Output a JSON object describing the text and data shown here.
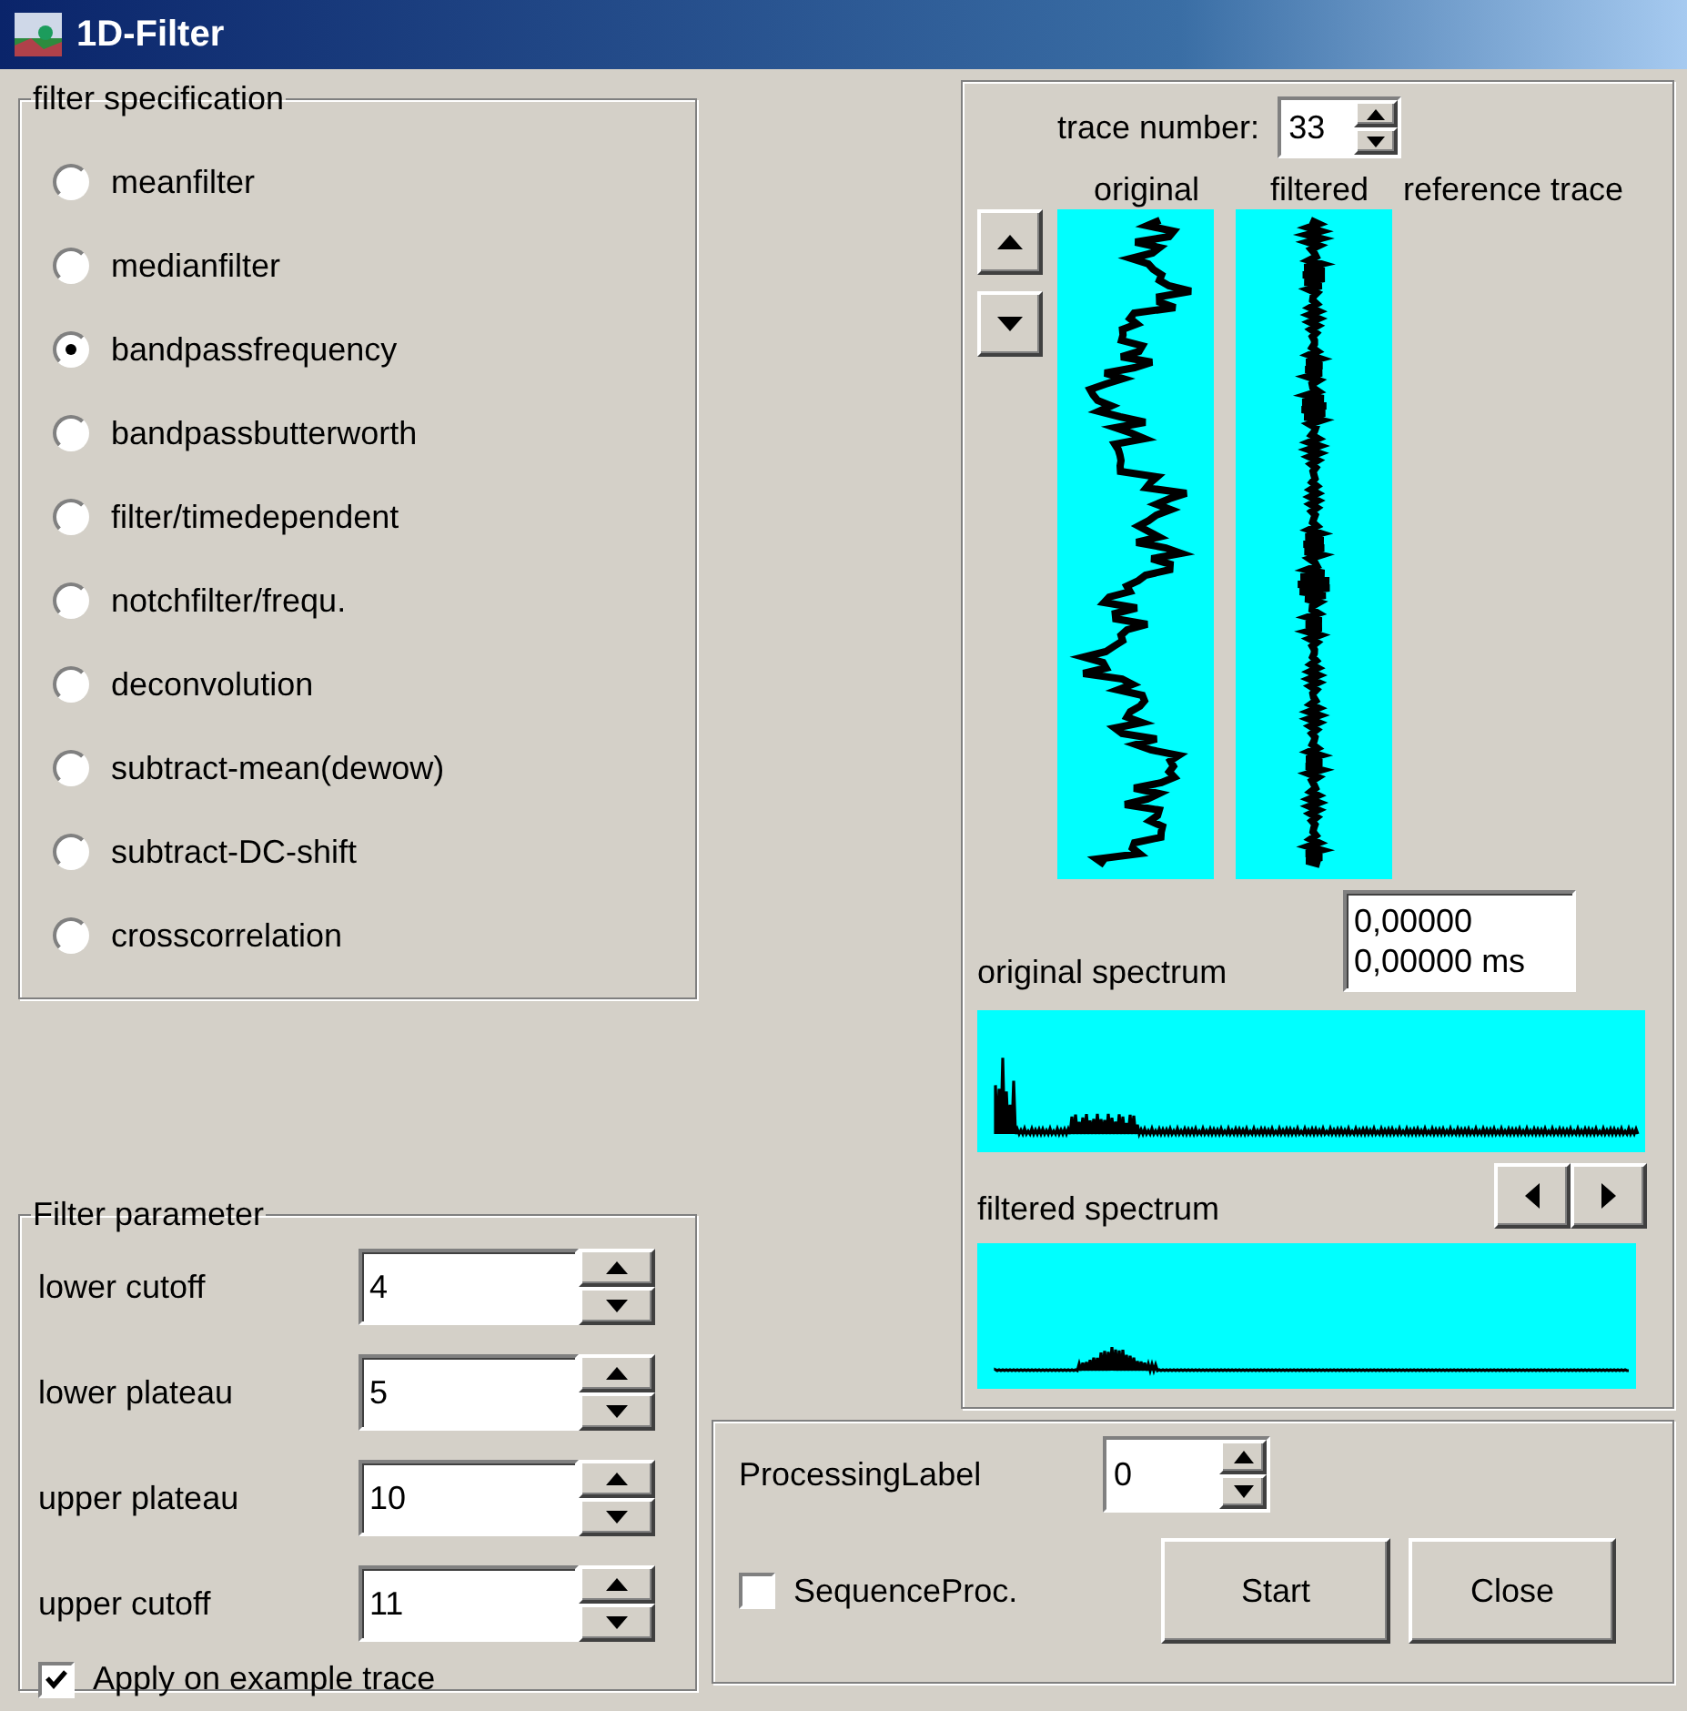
{
  "window": {
    "title": "1D-Filter"
  },
  "filter_specification": {
    "title": "filter specification",
    "options": [
      {
        "label": "meanfilter",
        "selected": false
      },
      {
        "label": "medianfilter",
        "selected": false
      },
      {
        "label": "bandpassfrequency",
        "selected": true
      },
      {
        "label": "bandpassbutterworth",
        "selected": false
      },
      {
        "label": "filter/timedependent",
        "selected": false
      },
      {
        "label": "notchfilter/frequ.",
        "selected": false
      },
      {
        "label": "deconvolution",
        "selected": false
      },
      {
        "label": "subtract-mean(dewow)",
        "selected": false
      },
      {
        "label": "subtract-DC-shift",
        "selected": false
      },
      {
        "label": "crosscorrelation",
        "selected": false
      }
    ]
  },
  "trace_panel": {
    "trace_number_label": "trace number:",
    "trace_number": "33",
    "column_headers": [
      "original",
      "filtered",
      "reference trace"
    ],
    "readout": [
      "0,00000",
      "0,00000 ms"
    ],
    "original_spectrum_label": "original spectrum",
    "filtered_spectrum_label": "filtered spectrum"
  },
  "filter_parameter": {
    "title": "Filter parameter",
    "fields": [
      {
        "label": "lower cutoff",
        "value": "4"
      },
      {
        "label": "lower plateau",
        "value": "5"
      },
      {
        "label": "upper plateau",
        "value": "10"
      },
      {
        "label": "upper cutoff",
        "value": "11"
      }
    ],
    "apply": {
      "label": "Apply on example trace",
      "checked": true
    }
  },
  "processing": {
    "label": "ProcessingLabel",
    "value": "0",
    "sequence": {
      "label": "SequenceProc.",
      "checked": false
    },
    "buttons": [
      "Start",
      "Close"
    ]
  }
}
